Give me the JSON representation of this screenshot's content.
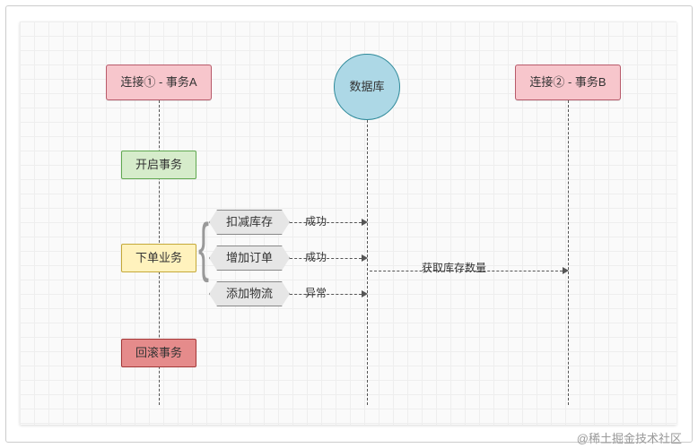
{
  "lanes": {
    "connA": "连接① - 事务A",
    "db": "数据库",
    "connB": "连接② - 事务B"
  },
  "steps": {
    "openTx": "开启事务",
    "orderBiz": "下单业务",
    "rollback": "回滚事务"
  },
  "ops": {
    "deductStock": "扣减库存",
    "addOrder": "增加订单",
    "addLogistics": "添加物流"
  },
  "results": {
    "deductStock": "成功",
    "addOrder": "成功",
    "addLogistics": "异常"
  },
  "crossMsg": "获取库存数量",
  "watermark": "@稀土掘金技术社区",
  "chart_data": {
    "type": "diagram",
    "subtype": "sequence-diagram",
    "title": "",
    "participants": [
      {
        "id": "connA",
        "label": "连接① - 事务A",
        "shape": "rect",
        "color": "#f7c6cc"
      },
      {
        "id": "db",
        "label": "数据库",
        "shape": "circle",
        "color": "#add8e6"
      },
      {
        "id": "connB",
        "label": "连接② - 事务B",
        "shape": "rect",
        "color": "#f7c6cc"
      }
    ],
    "connA_sequence": [
      {
        "step": "开启事务",
        "color": "green"
      },
      {
        "step": "下单业务",
        "color": "yellow",
        "sub_operations": [
          {
            "name": "扣减库存",
            "to": "db",
            "result": "成功"
          },
          {
            "name": "增加订单",
            "to": "db",
            "result": "成功"
          },
          {
            "name": "添加物流",
            "to": "db",
            "result": "异常"
          }
        ]
      },
      {
        "step": "回滚事务",
        "color": "red"
      }
    ],
    "messages": [
      {
        "from": "db",
        "to": "connB",
        "label": "获取库存数量",
        "approx_after": "增加订单"
      }
    ]
  }
}
